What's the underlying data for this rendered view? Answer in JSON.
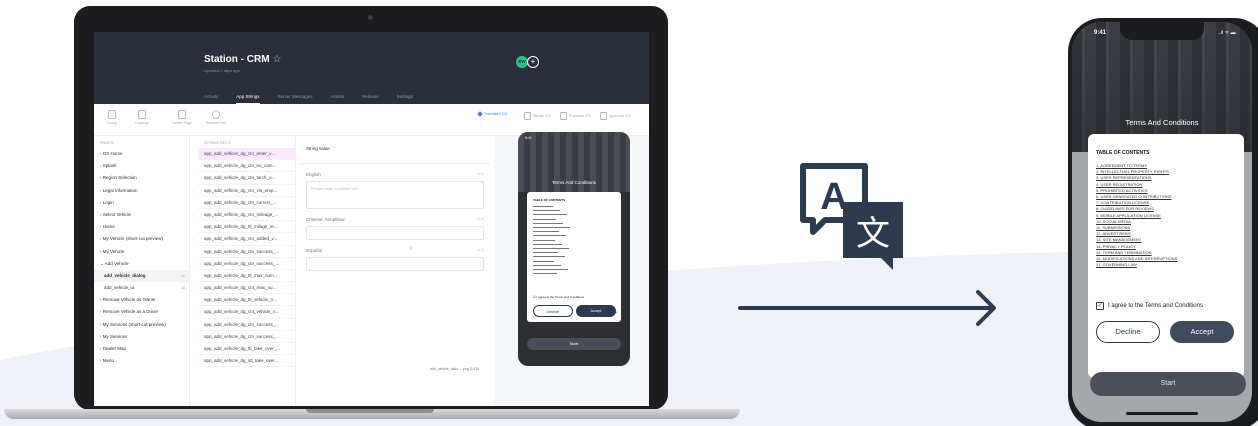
{
  "app": {
    "title": "Station  - CRM",
    "star": "☆",
    "updated": "Updated 2 days ago",
    "avatar_initials": "EW",
    "avatar_add": "+",
    "tabs": [
      "Activity",
      "App Strings",
      "Server Messages",
      "Assets",
      "Release",
      "Settings"
    ],
    "active_tab": "App Strings"
  },
  "toolbar": {
    "tools": [
      "Group",
      "Ungroup",
      "Delete Page",
      "Rename Key"
    ],
    "status": {
      "translated_label": "Translated",
      "translated_count": "124",
      "strings_label": "Strings",
      "strings_count": "300",
      "proposed_label": "Proposed",
      "proposed_count": "270",
      "approved_label": "Approved",
      "approved_count": "300"
    }
  },
  "pages": {
    "header": "PAGES",
    "items": [
      {
        "label": "OS Home",
        "child": false
      },
      {
        "label": "Splash",
        "child": false
      },
      {
        "label": "Region Selection",
        "child": false
      },
      {
        "label": "Legal Information",
        "child": false
      },
      {
        "label": "Login",
        "child": false
      },
      {
        "label": "Select Vehicle",
        "child": false
      },
      {
        "label": "Home",
        "child": false
      },
      {
        "label": "My Vehicle (short-cut preview)",
        "child": false
      },
      {
        "label": "My Vehicle",
        "child": false
      },
      {
        "label": "Add Vehicle",
        "child": false
      },
      {
        "label": "add_vehicle_dialog",
        "child": true,
        "count": "12"
      },
      {
        "label": "add_vehicle_ui",
        "child": true,
        "count": "18"
      },
      {
        "label": "Remove Vehicle as Owner",
        "child": false
      },
      {
        "label": "Remove Vehicle as a Driver",
        "child": false
      },
      {
        "label": "My Services (short-cut preview)",
        "child": false
      },
      {
        "label": "My Services",
        "child": false
      },
      {
        "label": "Dealer Map",
        "child": false
      },
      {
        "label": "Menu",
        "child": false
      }
    ]
  },
  "keys": {
    "header": "STRING KEYS",
    "items": [
      "app_add_vehicle_dg_ctn_enter_v...",
      "app_add_vehicle_dg_ctn_no_cam...",
      "app_add_vehicle_dg_ctn_torch_u...",
      "app_add_vehicle_dg_ctn_vin_emp...",
      "app_add_vehicle_dg_ctn_correct_...",
      "app_add_vehicle_dg_ctn_mileage_...",
      "app_add_vehicle_dg_ttl_milage_re...",
      "app_add_vehicle_dg_ctn_added_v...",
      "app_add_vehicle_dg_ctn_success_...",
      "app_add_vehicle_dg_ctn_success_...",
      "app_add_vehicle_dg_ttl_max_num...",
      "app_add_vehicle_dg_cnt_max_nu...",
      "app_add_vehicle_dg_ttl_vehicle_n...",
      "app_add_vehicle_dg_cnt_vehicle_n...",
      "app_add_vehicle_dg_ctn_success_...",
      "app_add_vehicle_dg_ctn_success_...",
      "app_add_vehicle_dg_ttl_take_over_...",
      "app_add_vehicle_dg_stl_take_over..."
    ]
  },
  "value": {
    "header": "String value",
    "langs": [
      {
        "name": "English",
        "placeholder": "Please enter a correct VIN",
        "limit": "0/15",
        "tall": true
      },
      {
        "name": "Chinese, Simplified",
        "placeholder": "",
        "limit": "0/15",
        "tall": false
      },
      {
        "name": "Español",
        "placeholder": "",
        "limit": "0/15",
        "tall": false
      }
    ]
  },
  "preview": {
    "caption": "add_vehicle_dialo... .png (1/18)",
    "nav_left": "‹",
    "nav_right": "›",
    "mini_status": "9:41",
    "mini_vin": "KNI KC41GRGD3E2345",
    "mini_stalker": "Stalker"
  },
  "phone": {
    "time": "9:41",
    "status_icons": "..ıl ᯤ ▬",
    "title": "Terms And Conditions",
    "toc_title": "TABLE OF CONTENTS",
    "toc_items": [
      "1. AGREEMENT TO TERMS",
      "2. INTELLECTUAL PROPERTY RIGHTS",
      "3. USER REPRESENTATIONS",
      "4. USER REGISTRATION",
      "5. PROHIBITED ACTIVITIES",
      "6. USER GENERATED CONTRIBUTIONS",
      "7. CONTRIBUTION LICENSE",
      "8. GUIDELINES FOR REVIEWS",
      "9. MOBILE APPLICATION LICENSE",
      "10. SOCIAL MEDIA",
      "11. SUBMISSIONS",
      "12. ADVERTISERS",
      "13. SITE MANAGEMENT",
      "14. PRIVACY POLICY",
      "15. TERM AND TERMINATION",
      "16. MODIFICATIONS AND INTERRUPTIONS",
      "17. GOVERNING LAW"
    ],
    "agree_label": "I agree to the Terms and Conditions",
    "checkmark": "✓",
    "decline_label": "Decline",
    "accept_label": "Accept",
    "start_label": "Start"
  },
  "translate_icon": {
    "letter_a": "A",
    "letter_zh": "文"
  },
  "colors": {
    "header_bg": "#2b2f3b",
    "accent_blue": "#3d7ef0",
    "selection_pink": "#fde8fb",
    "button_dark": "#3f4a5e",
    "avatar_green": "#23c38c"
  }
}
